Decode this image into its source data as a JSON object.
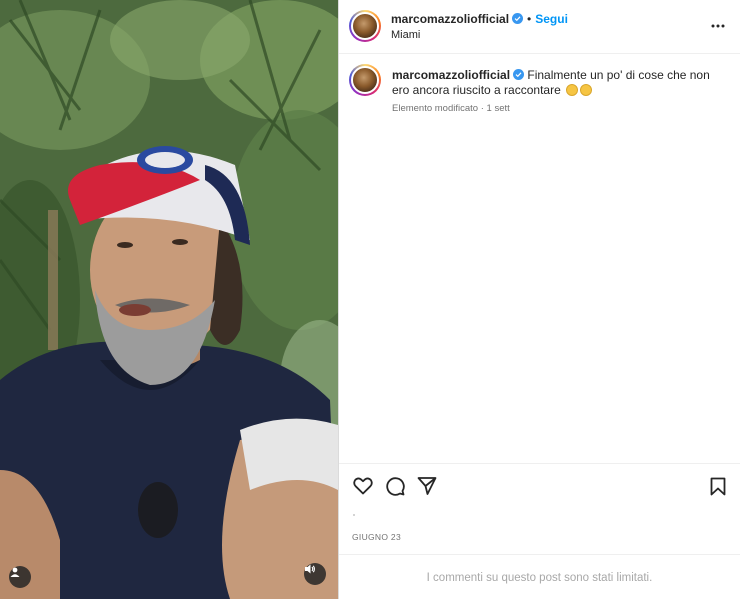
{
  "post": {
    "username": "marcomazzoliofficial",
    "verified": true,
    "follow_label": "Segui",
    "separator": "•",
    "location": "Miami",
    "more_icon": "more-horizontal-icon"
  },
  "caption": {
    "username": "marcomazzoliofficial",
    "text": "Finalmente un po' di cose che non ero ancora riuscito a raccontare",
    "emojis": [
      "grinning-face-emoji",
      "smiling-face-emoji"
    ],
    "edited_label": "Elemento modificato",
    "meta_separator": "·",
    "age": "1 sett"
  },
  "actions": {
    "like_icon": "heart-icon",
    "comment_icon": "comment-icon",
    "share_icon": "send-icon",
    "save_icon": "bookmark-icon"
  },
  "date": "GIUGNO 23",
  "comments_limited": "I commenti su questo post sono stati limitati.",
  "media": {
    "type": "video",
    "user_tag_icon": "user-tag-icon",
    "sound_icon": "sound-on-icon"
  },
  "colors": {
    "accent": "#0095f6",
    "verified": "#3897f0",
    "text": "#262626",
    "secondary": "#737373",
    "muted": "#a8a8a8"
  }
}
